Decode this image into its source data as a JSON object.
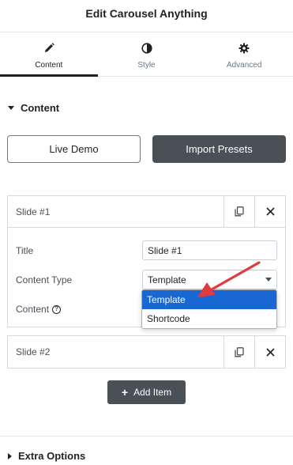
{
  "panel": {
    "title": "Edit Carousel Anything"
  },
  "tabs": [
    {
      "label": "Content",
      "icon": "pencil-icon",
      "active": true
    },
    {
      "label": "Style",
      "icon": "half-circle-icon",
      "active": false
    },
    {
      "label": "Advanced",
      "icon": "gear-icon",
      "active": false
    }
  ],
  "section": {
    "title": "Content"
  },
  "buttons": {
    "live_demo": "Live Demo",
    "import_presets": "Import Presets"
  },
  "slides": [
    {
      "title": "Slide #1",
      "expanded": true,
      "fields": {
        "title_label": "Title",
        "title_value": "Slide #1",
        "content_type_label": "Content Type",
        "content_type_value": "Template",
        "content_label": "Content"
      }
    },
    {
      "title": "Slide #2",
      "expanded": false
    }
  ],
  "dropdown": {
    "options": [
      "Template",
      "Shortcode"
    ],
    "selected": "Template"
  },
  "add_item": {
    "label": "Add Item"
  },
  "extra_section": {
    "title": "Extra Options"
  },
  "colors": {
    "accent_dark": "#495157",
    "selected_option": "#1967d2",
    "annotation_arrow": "#e0393e"
  }
}
